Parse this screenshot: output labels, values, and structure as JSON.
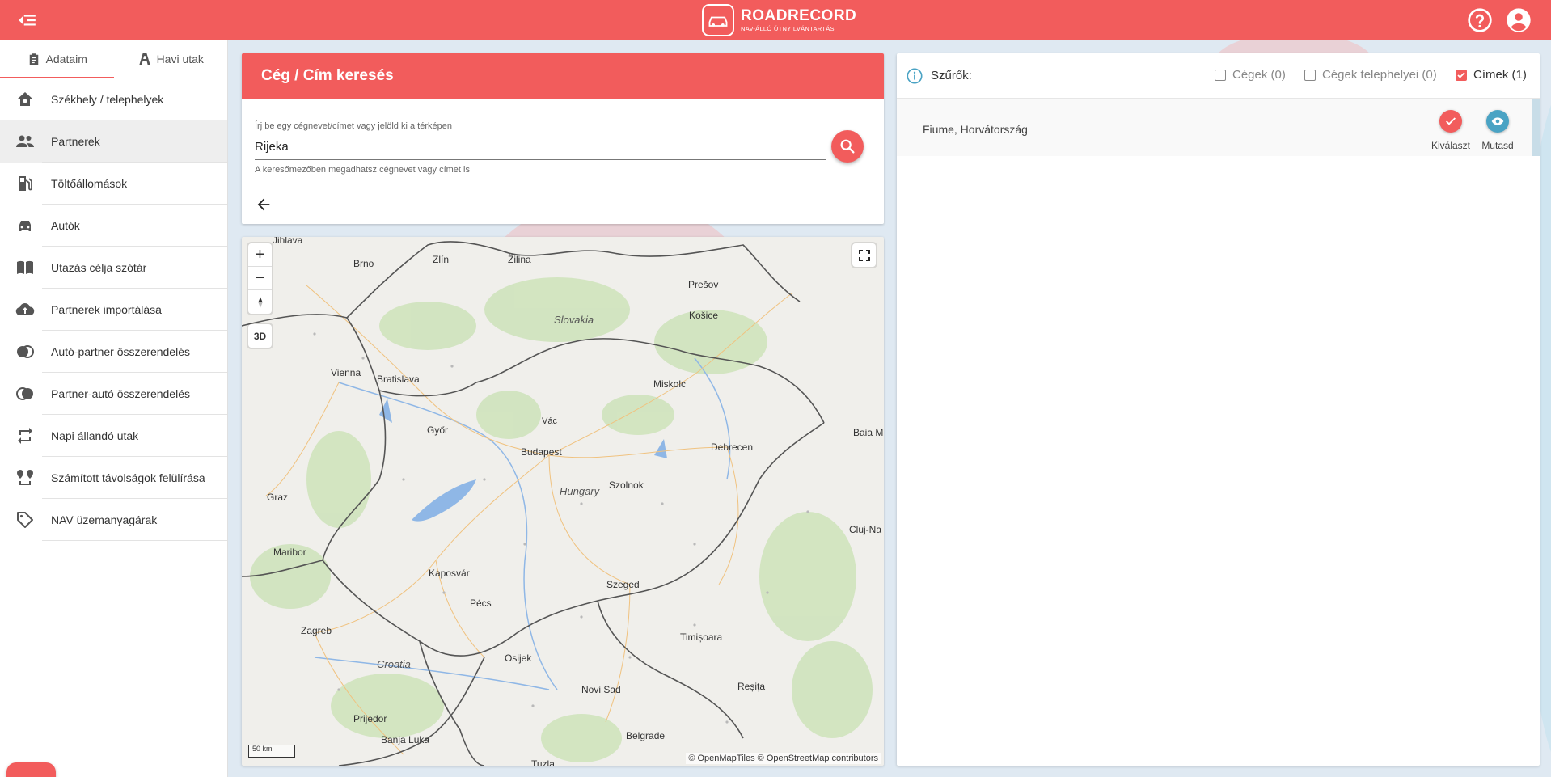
{
  "header": {
    "logo_title": "ROADRECORD",
    "logo_sub": "NAV-ÁLLÓ ÚTNYILVÁNTARTÁS",
    "icons": [
      "menu-back-icon",
      "help-icon",
      "account-icon"
    ],
    "accent": "#f25c5c"
  },
  "sidebar": {
    "tabs": [
      {
        "label": "Adataim",
        "icon": "clipboard-icon",
        "active": true
      },
      {
        "label": "Havi utak",
        "icon": "road-icon",
        "active": false
      }
    ],
    "items": [
      {
        "label": "Székhely / telephelyek",
        "icon": "home-icon"
      },
      {
        "label": "Partnerek",
        "icon": "people-icon",
        "active": true
      },
      {
        "label": "Töltőállomások",
        "icon": "fuel-icon"
      },
      {
        "label": "Autók",
        "icon": "car-icon"
      },
      {
        "label": "Utazás célja szótár",
        "icon": "book-icon"
      },
      {
        "label": "Partnerek importálása",
        "icon": "cloud-upload-icon"
      },
      {
        "label": "Autó-partner összerendelés",
        "icon": "link-icon"
      },
      {
        "label": "Partner-autó összerendelés",
        "icon": "link-icon"
      },
      {
        "label": "Napi állandó utak",
        "icon": "repeat-icon"
      },
      {
        "label": "Számított távolságok felülírása",
        "icon": "route-icon"
      },
      {
        "label": "NAV üzemanyagárak",
        "icon": "tag-icon"
      }
    ]
  },
  "search": {
    "title": "Cég / Cím keresés",
    "label": "Írj be egy cégnevet/címet vagy jelöld ki a térképen",
    "value": "Rijeka",
    "hint": "A keresőmezőben megadhatsz cégnevet vagy címet is"
  },
  "map": {
    "btn_3d": "3D",
    "scale": "50 km",
    "attribution": "© OpenMapTiles © OpenStreetMap contributors",
    "cities": [
      "Jihlava",
      "Brno",
      "Zlín",
      "Žilina",
      "Prešov",
      "Košice",
      "Vienna",
      "Bratislava",
      "Miskolc",
      "Győr",
      "Vác",
      "Budapest",
      "Debrecen",
      "Baia M",
      "Szolnok",
      "Graz",
      "Cluj-Na",
      "Maribor",
      "Kaposvár",
      "Pécs",
      "Szeged",
      "Zagreb",
      "Timișoara",
      "Osijek",
      "Novi Sad",
      "Reșița",
      "Prijedor",
      "Banja Luka",
      "Belgrade",
      "Tuzla"
    ],
    "countries": [
      "Slovakia",
      "Hungary",
      "Croatia"
    ]
  },
  "results": {
    "filter_title": "Szűrők:",
    "filters": [
      {
        "label": "Cégek (0)",
        "checked": false
      },
      {
        "label": "Cégek telephelyei (0)",
        "checked": false
      },
      {
        "label": "Címek (1)",
        "checked": true
      }
    ],
    "items": [
      {
        "text": "Fiume, Horvátország",
        "select_label": "Kiválaszt",
        "show_label": "Mutasd"
      }
    ]
  }
}
